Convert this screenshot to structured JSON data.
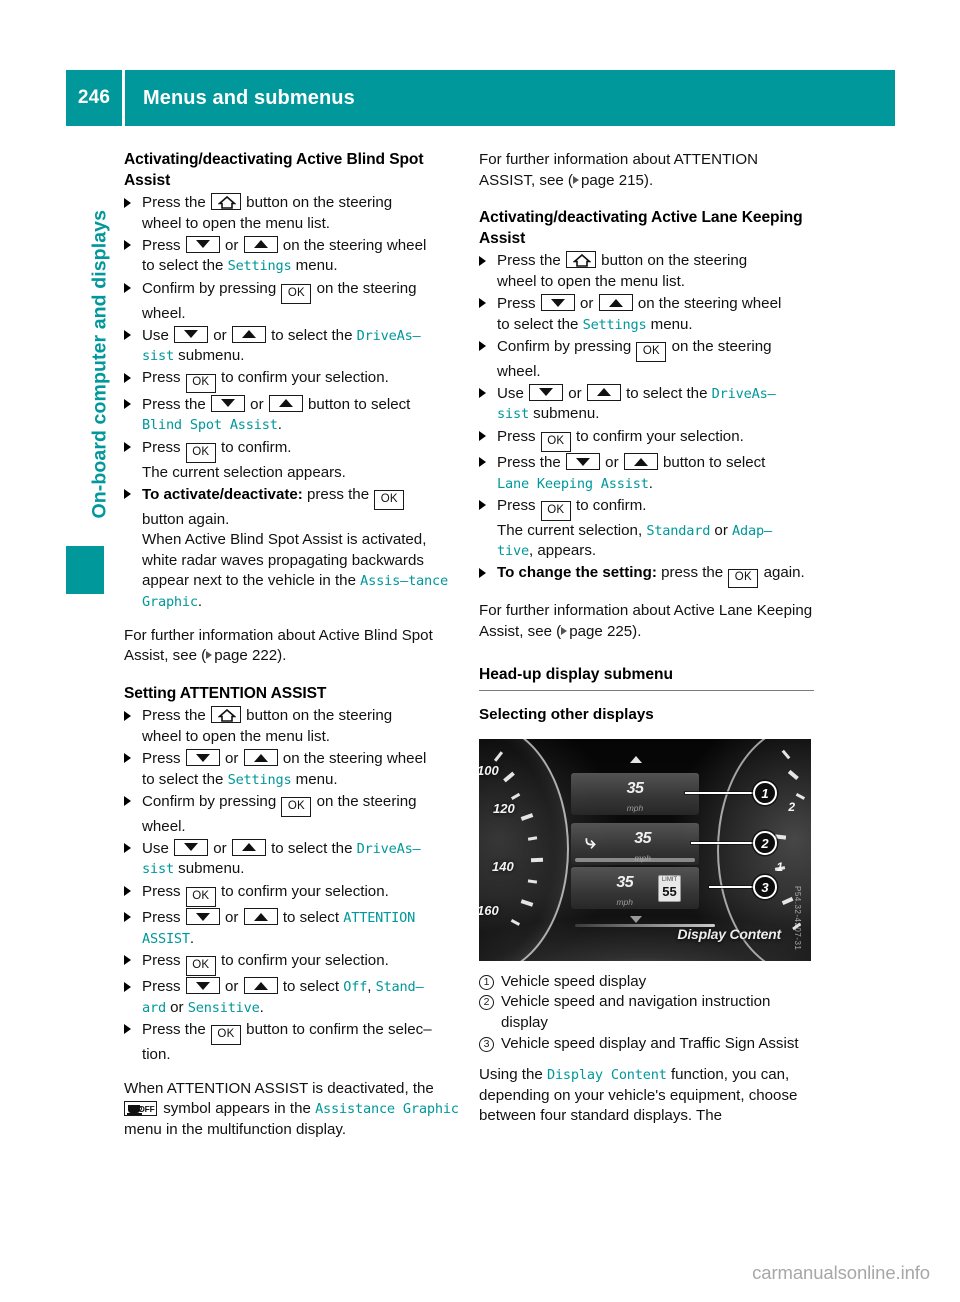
{
  "header": {
    "page_number": "246",
    "title": "Menus and submenus",
    "accent_color": "#00989b"
  },
  "sidebar": {
    "chapter_label": "On-board computer and displays"
  },
  "keys": {
    "ok": "OK",
    "home": "home-button",
    "down": "down-arrow-button",
    "up": "up-arrow-button"
  },
  "left_column": {
    "section1_title": "Activating/deactivating Active Blind Spot Assist",
    "steps1": [
      "Press the ⌂ button on the steering wheel to open the menu list.",
      "Press ▼ or ▲ on the steering wheel to select the Settings menu.",
      "Confirm by pressing OK on the steering wheel.",
      "Use ▼ or ▲ to select the DriveAssist submenu.",
      "Press OK to confirm your selection.",
      "Press the ▼ or ▲ button to select Blind Spot Assist.",
      "Press OK to confirm. The current selection appears.",
      "To activate/deactivate: press the OK button again."
    ],
    "note1": "When Active Blind Spot Assist is activated, white radar waves propagating backwards appear next to the vehicle in the Assistance Graphic.",
    "para1_a": "For further information about Active Blind",
    "para1_b": "Spot Assist, see (",
    "para1_page": "page 222",
    "section2_title": "Setting ATTENTION ASSIST",
    "steps2": [
      "Press the ⌂ button on the steering wheel to open the menu list.",
      "Press ▼ or ▲ on the steering wheel to select the Settings menu.",
      "Confirm by pressing OK on the steering wheel.",
      "Use ▼ or ▲ to select the DriveAssist submenu.",
      "Press OK to confirm your selection.",
      "Press ▼ or ▲ to select ATTENTION ASSIST.",
      "Press OK to confirm your selection.",
      "Press ▼ or ▲ to select Off, Standard or Sensitive.",
      "Press the OK button to confirm the selection."
    ],
    "note2_pre": "When ATTENTION ASSIST is deactivated, the",
    "note2_mid": "symbol appears in the",
    "note2_menu": "Assistance Graphic",
    "note2_post": "menu in the multifunction display."
  },
  "right_column": {
    "para_top_a": "For further information about ATTENTION",
    "para_top_b": "ASSIST, see (",
    "para_top_page": "page 215",
    "section1_title": "Activating/deactivating Active Lane Keeping Assist",
    "steps1": [
      "Press the ⌂ button on the steering wheel to open the menu list.",
      "Press ▼ or ▲ on the steering wheel to select the Settings menu.",
      "Confirm by pressing OK on the steering wheel.",
      "Use ▼ or ▲ to select the DriveAssist submenu.",
      "Press OK to confirm your selection.",
      "Press the ▼ or ▲ button to select Lane Keeping Assist.",
      "Press OK to confirm. The current selection, Standard or Adaptive, appears.",
      "To change the setting: press OK again."
    ],
    "para_mid_a": "For further information about Active Lane",
    "para_mid_b": "Keeping Assist, see (",
    "para_mid_page": "page 225",
    "rule_title": "Head-up display submenu",
    "subsection_title": "Selecting other displays",
    "legend": [
      {
        "num": "1",
        "text": "Vehicle speed display"
      },
      {
        "num": "2",
        "text": "Vehicle speed and navigation instruction display"
      },
      {
        "num": "3",
        "text": "Vehicle speed display and Traffic Sign Assist"
      }
    ],
    "closing_pre": "Using the",
    "closing_menu": "Display Content",
    "closing_post": "function, you can, depending on your vehicle's equipment, choose between four standard displays. The"
  },
  "figure": {
    "gauge_left_numbers": [
      "100",
      "120",
      "140",
      "160"
    ],
    "gauge_right_numbers": [
      "2",
      "1"
    ],
    "hud_rows": [
      {
        "speed": "35",
        "unit": "mph",
        "callout": "1"
      },
      {
        "speed": "35",
        "unit": "mph",
        "callout": "2"
      },
      {
        "speed": "35",
        "unit": "mph",
        "callout": "3"
      }
    ],
    "sign_limit_label": "LIMIT",
    "sign_value": "55",
    "caption_label": "Display Content",
    "image_code": "P54.32-4207-31"
  },
  "inline_terms": {
    "settings": "Settings",
    "driveassist_a": "DriveAs–",
    "driveassist_b": "sist",
    "blind_spot_assist": "Blind Spot Assist",
    "assistance_a": "Assis–",
    "assistance_b": "tance Graphic",
    "attention_a": "ATTENTION",
    "attention_b": "ASSIST",
    "off": "Off",
    "standard_a": "Stand–",
    "standard_b": "ard",
    "sensitive": "Sensitive",
    "lane_keeping_assist": "Lane Keeping Assist",
    "standard": "Standard",
    "adaptive_a": "Adap–",
    "adaptive_b": "tive"
  },
  "labels": {
    "to_activate_deactivate": "To activate/deactivate:",
    "to_change_setting": "To change the setting:",
    "press": "Press",
    "press_the": "Press the",
    "use": "Use",
    "or": "or",
    "button_on_steering": "button on the steering",
    "wheel_open_menu": "wheel to open the menu list.",
    "on_steering_wheel": "on the steering wheel",
    "to_select_the": "to select the",
    "menu_word": "menu.",
    "confirm_by_pressing": "Confirm by pressing",
    "on_the_steering": "on the steering",
    "wheel_word": "wheel.",
    "submenu_word": "submenu.",
    "to_confirm_your_selection": "to confirm your selection.",
    "button_to_select": "button to select",
    "to_confirm": "to confirm.",
    "current_selection_appears": "The current selection appears.",
    "press_the_lower": "press the",
    "button_again": "button again.",
    "to_select": "to select",
    "button_to_confirm": "button to confirm the selec–",
    "tion": "tion.",
    "again": "again.",
    "current_selection_comma": "The current selection,",
    "appears_word": ", appears.",
    "symbol_appears": "symbol appears in the",
    "menu_multifunction": "menu in the multifunction display."
  },
  "footer": {
    "watermark": "carmanualsonline.info"
  }
}
